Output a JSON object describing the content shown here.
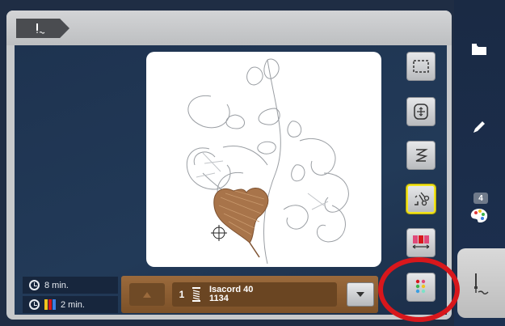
{
  "header": {
    "tab_icon": "needle-tab-icon"
  },
  "sidebar": {
    "items": [
      {
        "name": "folder-icon"
      },
      {
        "name": "pencil-icon"
      },
      {
        "name": "color-palette-icon",
        "badge": "4"
      },
      {
        "name": "embroidery-needle-icon",
        "active": true
      }
    ]
  },
  "tools": [
    {
      "name": "select-area-icon"
    },
    {
      "name": "move-hoop-icon"
    },
    {
      "name": "stitch-path-icon"
    },
    {
      "name": "cut-jump-icon",
      "active": true
    },
    {
      "name": "color-sequence-icon"
    },
    {
      "name": "color-dots-icon"
    }
  ],
  "times": {
    "total": "8 min.",
    "color": "2 min."
  },
  "thread": {
    "number": "1",
    "brand": "Isacord 40",
    "code": "1134"
  },
  "colors": {
    "accent_ring": "#d8171c",
    "active_tool_border": "#f1e41c",
    "thread_bar": "#8a5c31"
  }
}
